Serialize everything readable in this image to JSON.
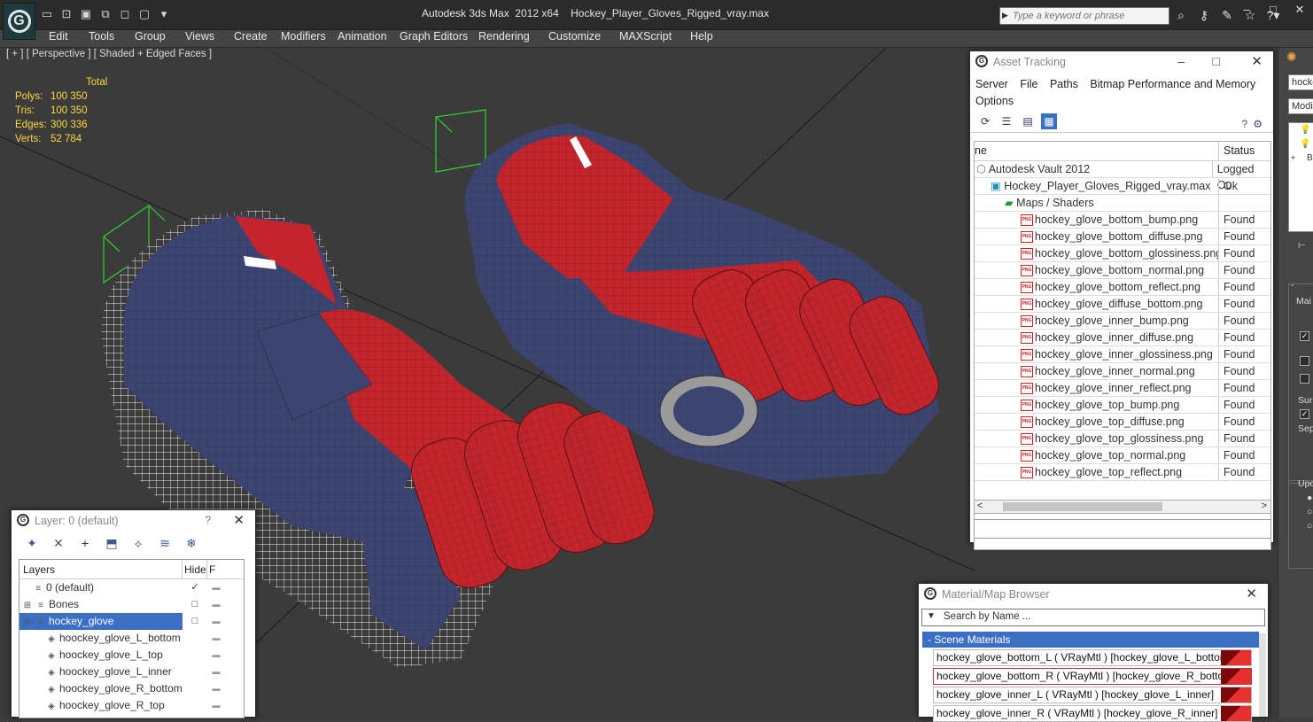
{
  "app": {
    "title": "Autodesk 3ds Max  2012 x64    Hockey_Player_Gloves_Rigged_vray.max",
    "logo_icon": "3ds-max-logo-icon",
    "search_placeholder": "Type a keyword or phrase",
    "qat_icons": [
      "new-file-icon",
      "open-folder-icon",
      "save-icon",
      "undo-icon",
      "redo-icon",
      "project-folder-icon",
      "dropdown-arrow-icon"
    ],
    "top_icons": [
      "binoculars-icon",
      "key-icon",
      "bookmark-icon",
      "star-icon",
      "help-icon"
    ],
    "window_buttons": {
      "min": "–",
      "max": "□",
      "close": "✕"
    }
  },
  "menubar": {
    "items": [
      "Edit",
      "Tools",
      "Group",
      "Views",
      "Create",
      "Modifiers",
      "Animation",
      "Graph Editors",
      "Rendering",
      "Customize",
      "MAXScript",
      "Help"
    ]
  },
  "viewport": {
    "label": "[ + ] [ Perspective ] [ Shaded + Edged Faces ]",
    "stats": {
      "header": "Total",
      "rows": [
        {
          "label": "Polys:",
          "value": "100 350"
        },
        {
          "label": "Tris:",
          "value": "100 350"
        },
        {
          "label": "Edges:",
          "value": "300 336"
        },
        {
          "label": "Verts:",
          "value": "52 784"
        }
      ]
    },
    "colors": {
      "glove_red": "#c4242c",
      "glove_blue": "#3c4572",
      "bbox_green": "#2bd62b",
      "stats_yellow": "#ffd840"
    }
  },
  "asset_tracking": {
    "title": "Asset Tracking",
    "menu": [
      "Server",
      "File",
      "Paths",
      "Bitmap Performance and Memory",
      "Options"
    ],
    "columns": [
      "ne",
      "Status"
    ],
    "rows": [
      {
        "name": "Autodesk Vault 2012",
        "status": "Logged Ou",
        "indent": 0,
        "icon": "vault-icon"
      },
      {
        "name": "Hockey_Player_Gloves_Rigged_vray.max",
        "status": "Ok",
        "indent": 1,
        "icon": "max-file-icon"
      },
      {
        "name": "Maps / Shaders",
        "status": "",
        "indent": 2,
        "icon": "maps-folder-icon"
      },
      {
        "name": "hockey_glove_bottom_bump.png",
        "status": "Found",
        "indent": 3,
        "icon": "png-icon"
      },
      {
        "name": "hockey_glove_bottom_diffuse.png",
        "status": "Found",
        "indent": 3,
        "icon": "png-icon"
      },
      {
        "name": "hockey_glove_bottom_glossiness.png",
        "status": "Found",
        "indent": 3,
        "icon": "png-icon"
      },
      {
        "name": "hockey_glove_bottom_normal.png",
        "status": "Found",
        "indent": 3,
        "icon": "png-icon"
      },
      {
        "name": "hockey_glove_bottom_reflect.png",
        "status": "Found",
        "indent": 3,
        "icon": "png-icon"
      },
      {
        "name": "hockey_glove_diffuse_bottom.png",
        "status": "Found",
        "indent": 3,
        "icon": "png-icon"
      },
      {
        "name": "hockey_glove_inner_bump.png",
        "status": "Found",
        "indent": 3,
        "icon": "png-icon"
      },
      {
        "name": "hockey_glove_inner_diffuse.png",
        "status": "Found",
        "indent": 3,
        "icon": "png-icon"
      },
      {
        "name": "hockey_glove_inner_glossiness.png",
        "status": "Found",
        "indent": 3,
        "icon": "png-icon"
      },
      {
        "name": "hockey_glove_inner_normal.png",
        "status": "Found",
        "indent": 3,
        "icon": "png-icon"
      },
      {
        "name": "hockey_glove_inner_reflect.png",
        "status": "Found",
        "indent": 3,
        "icon": "png-icon"
      },
      {
        "name": "hockey_glove_top_bump.png",
        "status": "Found",
        "indent": 3,
        "icon": "png-icon"
      },
      {
        "name": "hockey_glove_top_diffuse.png",
        "status": "Found",
        "indent": 3,
        "icon": "png-icon"
      },
      {
        "name": "hockey_glove_top_glossiness.png",
        "status": "Found",
        "indent": 3,
        "icon": "png-icon"
      },
      {
        "name": "hockey_glove_top_normal.png",
        "status": "Found",
        "indent": 3,
        "icon": "png-icon"
      },
      {
        "name": "hockey_glove_top_reflect.png",
        "status": "Found",
        "indent": 3,
        "icon": "png-icon"
      }
    ]
  },
  "layer_dialog": {
    "title": "Layer: 0 (default)",
    "help": "?",
    "columns": {
      "name": "Layers",
      "hide": "Hide",
      "f": "F"
    },
    "toolbar_icons": [
      "new-layer-icon",
      "delete-layer-icon",
      "add-to-layer-icon",
      "select-in-layer-icon",
      "highlight-layer-icon",
      "hide-all-icon",
      "freeze-all-icon"
    ],
    "rows": [
      {
        "name": "0 (default)",
        "hide": "✓",
        "selected": false,
        "indent": 1,
        "icon": "layer-stack-icon"
      },
      {
        "name": "Bones",
        "hide": "□",
        "selected": false,
        "indent": 0,
        "icon": "layer-stack-icon"
      },
      {
        "name": "hockey_glove",
        "hide": "□",
        "selected": true,
        "indent": 0,
        "icon": "layer-stack-icon"
      },
      {
        "name": "hoockey_glove_L_bottom",
        "hide": "",
        "selected": false,
        "indent": 2,
        "icon": "object-cube-icon"
      },
      {
        "name": "hoockey_glove_L_top",
        "hide": "",
        "selected": false,
        "indent": 2,
        "icon": "object-cube-icon"
      },
      {
        "name": "hoockey_glove_L_inner",
        "hide": "",
        "selected": false,
        "indent": 2,
        "icon": "object-cube-icon"
      },
      {
        "name": "hoockey_glove_R_bottom",
        "hide": "",
        "selected": false,
        "indent": 2,
        "icon": "object-cube-icon"
      },
      {
        "name": "hoockey_glove_R_top",
        "hide": "",
        "selected": false,
        "indent": 2,
        "icon": "object-cube-icon"
      }
    ]
  },
  "material_browser": {
    "title": "Material/Map Browser",
    "search_placeholder": "Search by Name ...",
    "category": "- Scene Materials",
    "items": [
      {
        "label": "hockey_glove_bottom_L ( VRayMtl ) [hockey_glove_L_bottom]",
        "highlight": false
      },
      {
        "label": "hockey_glove_bottom_R ( VRayMtl ) [hockey_glove_R_bottom]",
        "highlight": true
      },
      {
        "label": "hockey_glove_inner_L  ( VRayMtl ) [hockey_glove_L_inner]",
        "highlight": false
      },
      {
        "label": "hockey_glove_inner_R  ( VRayMtl ) [hockey_glove_R_inner]",
        "highlight": false
      }
    ]
  },
  "command_panel": {
    "name_field": "hocke",
    "modifier_list": "Modif",
    "labels": [
      "Mai",
      "Sur",
      "Sep",
      "Upo"
    ],
    "stack_labels": [
      "B"
    ]
  }
}
